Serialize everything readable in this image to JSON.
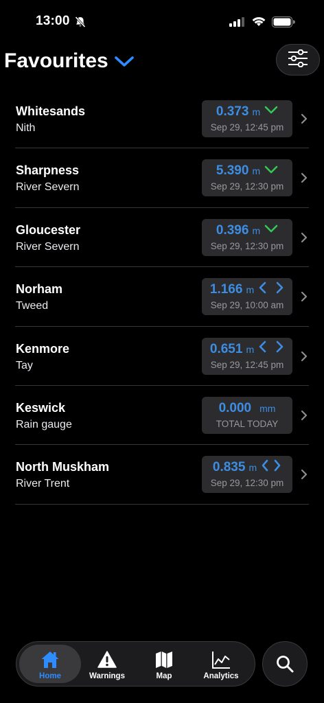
{
  "status_bar": {
    "time": "13:00",
    "icons": [
      "bell-slash-icon",
      "cellular-signal-icon",
      "wifi-icon",
      "battery-icon"
    ]
  },
  "header": {
    "title": "Favourites",
    "title_icon": "chevron-down-icon",
    "filter_icon": "sliders-icon"
  },
  "colors": {
    "accent": "#2e8cff",
    "value_blue": "#3d8de3",
    "trend_down_green": "#34c759",
    "background": "#000000",
    "card": "#2c2c2e"
  },
  "stations": [
    {
      "name": "Whitesands",
      "river": "Nith",
      "value": "0.373",
      "unit": "m",
      "trend": "down",
      "subtitle": "Sep 29, 12:45 pm"
    },
    {
      "name": "Sharpness",
      "river": "River Severn",
      "value": "5.390",
      "unit": "m",
      "trend": "down",
      "subtitle": "Sep 29, 12:30 pm"
    },
    {
      "name": "Gloucester",
      "river": "River Severn",
      "value": "0.396",
      "unit": "m",
      "trend": "down",
      "subtitle": "Sep 29, 12:30 pm"
    },
    {
      "name": "Norham",
      "river": "Tweed",
      "value": "1.166",
      "unit": "m",
      "trend": "steady",
      "subtitle": "Sep 29, 10:00 am"
    },
    {
      "name": "Kenmore",
      "river": "Tay",
      "value": "0.651",
      "unit": "m",
      "trend": "steady",
      "subtitle": "Sep 29, 12:45 pm"
    },
    {
      "name": "Keswick",
      "river": "Rain gauge",
      "value": "0.000",
      "unit": "mm",
      "trend": "none",
      "subtitle": "TOTAL TODAY"
    },
    {
      "name": "North Muskham",
      "river": "River Trent",
      "value": "0.835",
      "unit": "m",
      "trend": "steady",
      "subtitle": "Sep 29, 12:30 pm"
    }
  ],
  "tabs": [
    {
      "label": "Home",
      "icon": "house-icon",
      "active": true
    },
    {
      "label": "Warnings",
      "icon": "warning-triangle-icon",
      "active": false
    },
    {
      "label": "Map",
      "icon": "map-icon",
      "active": false
    },
    {
      "label": "Analytics",
      "icon": "line-chart-icon",
      "active": false
    }
  ],
  "search": {
    "icon": "search-icon"
  }
}
